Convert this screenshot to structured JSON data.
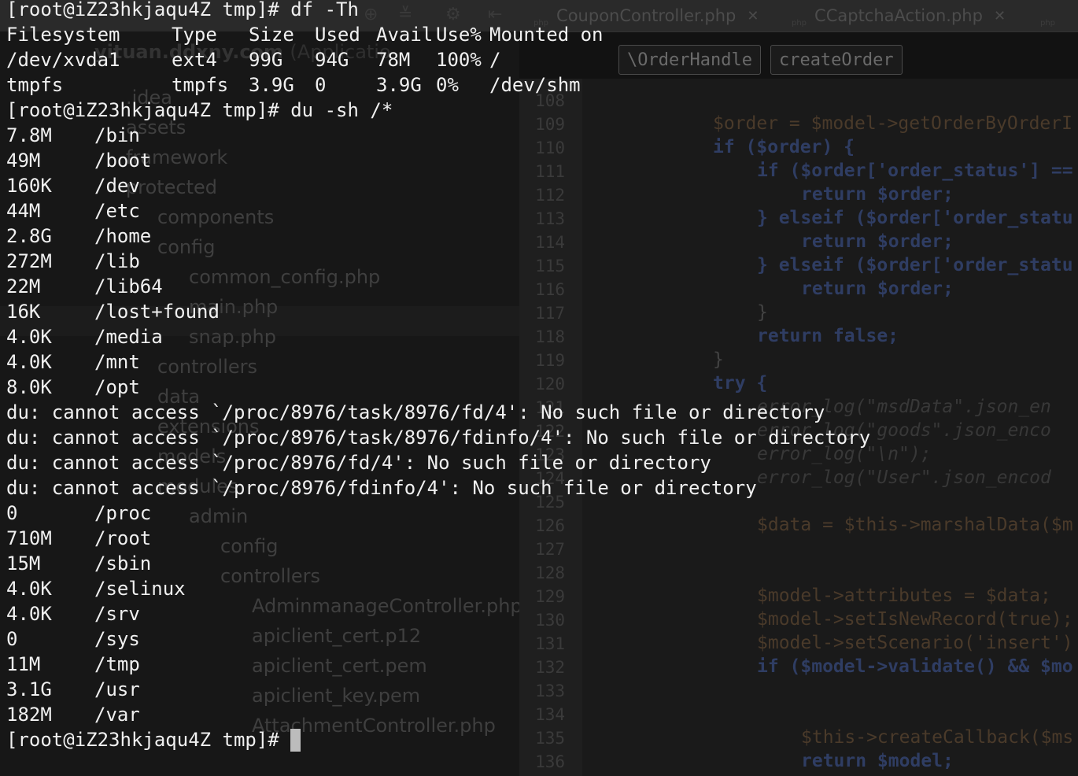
{
  "ide": {
    "tabs": [
      {
        "type": "php",
        "label": "CouponController.php"
      },
      {
        "type": "php",
        "label": "CCaptchaAction.php"
      },
      {
        "type": "php",
        "label": ""
      }
    ],
    "breadcrumbs": [
      "\\OrderHandle",
      "createOrder"
    ],
    "project": {
      "name": "yituan.ddxny.com",
      "path": "(Applicatio"
    },
    "tree": [
      {
        "label": ".idea",
        "indent": 0
      },
      {
        "label": "assets",
        "indent": 0
      },
      {
        "label": "framework",
        "indent": 0
      },
      {
        "label": "protected",
        "indent": 0
      },
      {
        "label": "components",
        "indent": 1
      },
      {
        "label": "config",
        "indent": 1
      },
      {
        "label": "common_config.php",
        "indent": 2
      },
      {
        "label": "main.php",
        "indent": 2
      },
      {
        "label": "snap.php",
        "indent": 2
      },
      {
        "label": "controllers",
        "indent": 1
      },
      {
        "label": "data",
        "indent": 1
      },
      {
        "label": "extensions",
        "indent": 1
      },
      {
        "label": "models",
        "indent": 1
      },
      {
        "label": "modules",
        "indent": 1
      },
      {
        "label": "admin",
        "indent": 2
      },
      {
        "label": "config",
        "indent": 3
      },
      {
        "label": "controllers",
        "indent": 3
      },
      {
        "label": "AdminmanageController.php",
        "indent": 4
      },
      {
        "label": "apiclient_cert.p12",
        "indent": 4
      },
      {
        "label": "apiclient_cert.pem",
        "indent": 4
      },
      {
        "label": "apiclient_key.pem",
        "indent": 4
      },
      {
        "label": "AttachmentController.php",
        "indent": 4
      }
    ],
    "line_numbers": [
      "108",
      "109",
      "110",
      "111",
      "112",
      "113",
      "114",
      "115",
      "116",
      "117",
      "118",
      "119",
      "120",
      "121",
      "122",
      "123",
      "124",
      "125",
      "126",
      "127",
      "128",
      "129",
      "130",
      "131",
      "132",
      "133",
      "134",
      "135",
      "136"
    ],
    "code": [
      {
        "line": 1,
        "indent": 4,
        "cls": "var",
        "text": "$order = $model->getOrderByOrderI"
      },
      {
        "line": 2,
        "indent": 4,
        "cls": "kw",
        "text": "if ($order) {"
      },
      {
        "line": 3,
        "indent": 5,
        "cls": "kw",
        "text": "if ($order['order_status'] =="
      },
      {
        "line": 4,
        "indent": 6,
        "cls": "kw",
        "text": "return $order;"
      },
      {
        "line": 5,
        "indent": 5,
        "cls": "kw",
        "text": "} elseif ($order['order_statu"
      },
      {
        "line": 6,
        "indent": 6,
        "cls": "kw",
        "text": "return $order;"
      },
      {
        "line": 7,
        "indent": 5,
        "cls": "kw",
        "text": "} elseif ($order['order_statu"
      },
      {
        "line": 8,
        "indent": 6,
        "cls": "kw",
        "text": "return $order;"
      },
      {
        "line": 9,
        "indent": 5,
        "cls": "",
        "text": "}"
      },
      {
        "line": 10,
        "indent": 5,
        "cls": "kw",
        "text": "return false;"
      },
      {
        "line": 11,
        "indent": 4,
        "cls": "",
        "text": "}"
      },
      {
        "line": 12,
        "indent": 4,
        "cls": "kw",
        "text": "try {"
      },
      {
        "line": 13,
        "indent": 5,
        "cls": "cmt",
        "text": "error_log(\"msdData\".json_en"
      },
      {
        "line": 14,
        "indent": 5,
        "cls": "cmt",
        "text": "error_log(\"goods\".json_enco"
      },
      {
        "line": 15,
        "indent": 5,
        "cls": "cmt",
        "text": "error_log(\"\\n\");"
      },
      {
        "line": 16,
        "indent": 5,
        "cls": "cmt",
        "text": "error_log(\"User\".json_encod"
      },
      {
        "line": 18,
        "indent": 5,
        "cls": "var",
        "text": "$data = $this->marshalData($m"
      },
      {
        "line": 21,
        "indent": 5,
        "cls": "var",
        "text": "$model->attributes = $data;"
      },
      {
        "line": 22,
        "indent": 5,
        "cls": "var",
        "text": "$model->setIsNewRecord(true);"
      },
      {
        "line": 23,
        "indent": 5,
        "cls": "var",
        "text": "$model->setScenario('insert')"
      },
      {
        "line": 24,
        "indent": 5,
        "cls": "kw",
        "text": "if ($model->validate() && $mo"
      },
      {
        "line": 27,
        "indent": 6,
        "cls": "var",
        "text": "$this->createCallback($ms"
      },
      {
        "line": 28,
        "indent": 6,
        "cls": "kw",
        "text": "return $model;"
      }
    ]
  },
  "terminal": {
    "prompt": "[root@iZ23hkjaqu4Z tmp]# ",
    "cmd_df": "df -Th",
    "df": {
      "header": [
        "Filesystem",
        "Type",
        "Size",
        "Used",
        "Avail",
        "Use%",
        "Mounted on"
      ],
      "rows": [
        [
          "/dev/xvda1",
          "ext4",
          "99G",
          "94G",
          "78M",
          "100%",
          "/"
        ],
        [
          "tmpfs",
          "tmpfs",
          "3.9G",
          "0",
          "3.9G",
          "0%",
          "/dev/shm"
        ]
      ]
    },
    "cmd_du": "du -sh /*",
    "du_first": [
      [
        "7.8M",
        "/bin"
      ],
      [
        "49M",
        "/boot"
      ],
      [
        "160K",
        "/dev"
      ],
      [
        "44M",
        "/etc"
      ],
      [
        "2.8G",
        "/home"
      ],
      [
        "272M",
        "/lib"
      ],
      [
        "22M",
        "/lib64"
      ],
      [
        "16K",
        "/lost+found"
      ],
      [
        "4.0K",
        "/media"
      ],
      [
        "4.0K",
        "/mnt"
      ],
      [
        "8.0K",
        "/opt"
      ]
    ],
    "errors": [
      "du: cannot access `/proc/8976/task/8976/fd/4': No such file or directory",
      "du: cannot access `/proc/8976/task/8976/fdinfo/4': No such file or directory",
      "du: cannot access `/proc/8976/fd/4': No such file or directory",
      "du: cannot access `/proc/8976/fdinfo/4': No such file or directory"
    ],
    "du_second": [
      [
        "0",
        "/proc"
      ],
      [
        "710M",
        "/root"
      ],
      [
        "15M",
        "/sbin"
      ],
      [
        "4.0K",
        "/selinux"
      ],
      [
        "4.0K",
        "/srv"
      ],
      [
        "0",
        "/sys"
      ],
      [
        "11M",
        "/tmp"
      ],
      [
        "3.1G",
        "/usr"
      ],
      [
        "182M",
        "/var"
      ]
    ]
  }
}
